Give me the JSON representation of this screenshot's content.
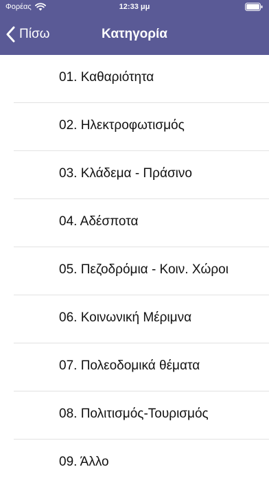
{
  "status_bar": {
    "carrier": "Φορέας",
    "time": "12:33 μμ"
  },
  "nav": {
    "back_label": "Πίσω",
    "title": "Κατηγορία"
  },
  "colors": {
    "header_background": "#5a5a96",
    "header_text": "#ffffff",
    "separator": "#e2e2e2"
  },
  "icons": {
    "wifi": "wifi-icon",
    "battery": "battery-icon",
    "back": "chevron-left-icon"
  },
  "categories": [
    {
      "label": "01. Καθαριότητα"
    },
    {
      "label": "02. Ηλεκτροφωτισμός"
    },
    {
      "label": "03. Κλάδεμα - Πράσινο"
    },
    {
      "label": "04. Αδέσποτα"
    },
    {
      "label": "05. Πεζοδρόμια - Κοιν. Χώροι"
    },
    {
      "label": "06. Κοινωνική Μέριμνα"
    },
    {
      "label": "07. Πολεοδομικά θέματα"
    },
    {
      "label": "08. Πολιτισμός-Τουρισμός"
    },
    {
      "label": "09. Άλλο"
    }
  ]
}
